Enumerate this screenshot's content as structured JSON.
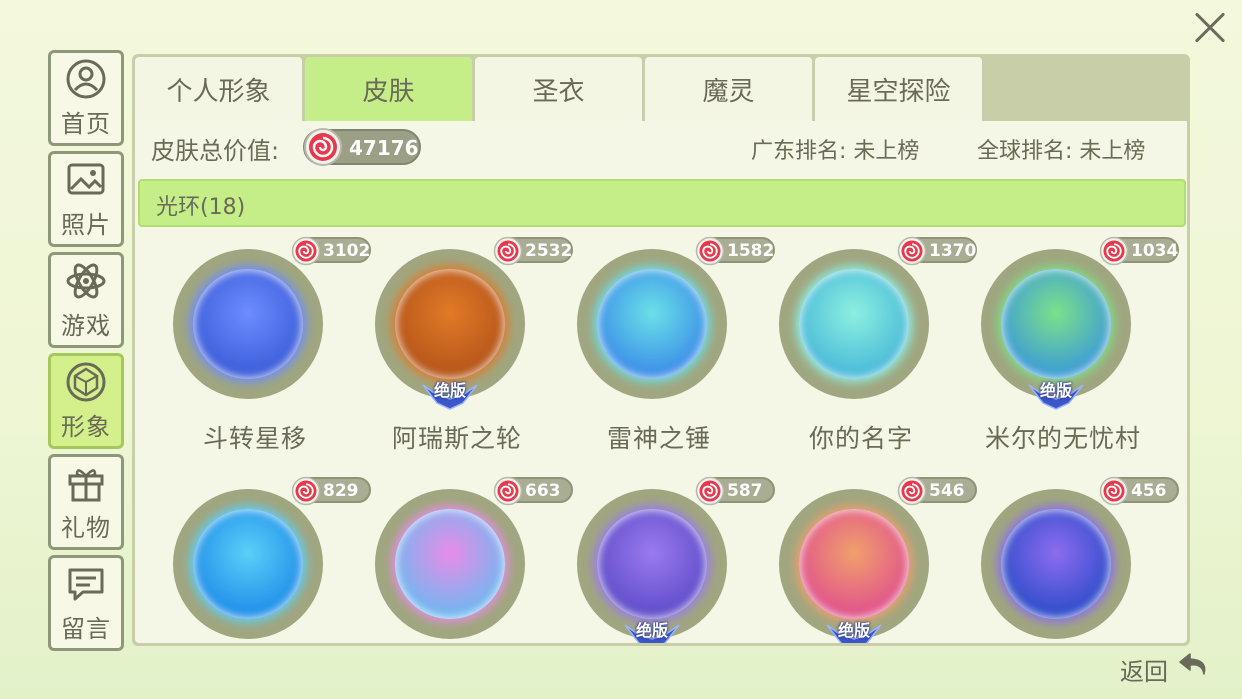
{
  "close": {
    "icon": "close-icon"
  },
  "sidebar": {
    "items": [
      {
        "label": "首页",
        "icon": "user-circle-icon"
      },
      {
        "label": "照片",
        "icon": "image-icon"
      },
      {
        "label": "游戏",
        "icon": "atom-icon"
      },
      {
        "label": "形象",
        "icon": "gem-icon",
        "active": true
      },
      {
        "label": "礼物",
        "icon": "gift-icon"
      },
      {
        "label": "留言",
        "icon": "message-icon"
      }
    ]
  },
  "tabs": [
    {
      "label": "个人形象"
    },
    {
      "label": "皮肤",
      "active": true
    },
    {
      "label": "圣衣"
    },
    {
      "label": "魔灵"
    },
    {
      "label": "星空探险"
    }
  ],
  "stats": {
    "total_label": "皮肤总价值:",
    "total_value": "47176",
    "province_rank": "广东排名: 未上榜",
    "global_rank": "全球排名: 未上榜"
  },
  "category": {
    "label": "光环(18)"
  },
  "badge_text": "绝版",
  "items": [
    {
      "price": "3102",
      "name": "斗转星移",
      "limited": false,
      "colors": [
        "#6c8cff",
        "#3a5cd8"
      ]
    },
    {
      "price": "2532",
      "name": "阿瑞斯之轮",
      "limited": true,
      "colors": [
        "#e07a28",
        "#b45418"
      ]
    },
    {
      "price": "1582",
      "name": "雷神之锤",
      "limited": false,
      "colors": [
        "#6ae0e8",
        "#3a8ce8"
      ]
    },
    {
      "price": "1370",
      "name": "你的名字",
      "limited": false,
      "colors": [
        "#8cf0e0",
        "#48b8d8"
      ]
    },
    {
      "price": "1034",
      "name": "米尔的无忧村",
      "limited": true,
      "colors": [
        "#7ce08a",
        "#3a9ad8"
      ]
    },
    {
      "price": "829",
      "name": "",
      "limited": false,
      "colors": [
        "#5ad0f8",
        "#1e8ce8"
      ]
    },
    {
      "price": "663",
      "name": "",
      "limited": false,
      "colors": [
        "#e88ce8",
        "#6cb8f0"
      ]
    },
    {
      "price": "587",
      "name": "",
      "limited": true,
      "colors": [
        "#9a7af0",
        "#5e4cc8"
      ]
    },
    {
      "price": "546",
      "name": "",
      "limited": true,
      "colors": [
        "#f0a06c",
        "#e0508c"
      ]
    },
    {
      "price": "456",
      "name": "",
      "limited": false,
      "colors": [
        "#8c6cf0",
        "#2c4cc8"
      ]
    }
  ],
  "back": {
    "label": "返回",
    "icon": "return-arrow-icon"
  }
}
